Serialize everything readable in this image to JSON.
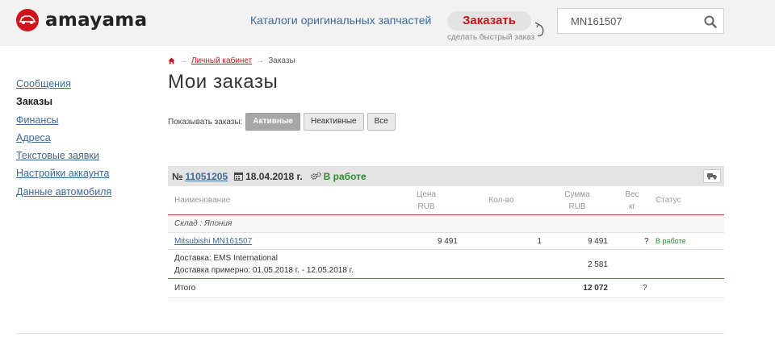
{
  "header": {
    "logo_text": "amayama",
    "catalog_link": "Каталоги оригинальных запчастей",
    "order_button": "Заказать",
    "order_subtext": "сделать быстрый заказ",
    "search_value": "MN161507",
    "search_icon": "search-icon"
  },
  "sidebar": {
    "items": [
      {
        "label": "Сообщения",
        "active": false
      },
      {
        "label": "Заказы",
        "active": true
      },
      {
        "label": "Финансы",
        "active": false
      },
      {
        "label": "Адреса",
        "active": false
      },
      {
        "label": "Текстовые заявки",
        "active": false
      },
      {
        "label": "Настройки аккаунта",
        "active": false
      },
      {
        "label": "Данные автомобиля",
        "active": false
      }
    ]
  },
  "breadcrumb": {
    "home_icon": "home-icon",
    "cabinet": "Личный кабинет",
    "current": "Заказы"
  },
  "page_title": "Мои заказы",
  "filter": {
    "label": "Показывать заказы:",
    "buttons": [
      "Активные",
      "Неактивные",
      "Все"
    ],
    "selected": "Активные"
  },
  "order": {
    "num_prefix": "№",
    "number": "11051205",
    "date": "18.04.2018 г.",
    "status": "В работе",
    "columns": {
      "name": "Наименование",
      "price": "Цена",
      "price_unit": "RUB",
      "qty": "Кол-во",
      "sum": "Сумма",
      "sum_unit": "RUB",
      "weight": "Вес",
      "weight_unit": "кг",
      "status": "Статус"
    },
    "warehouse": "Склад : Япония",
    "item": {
      "name": "Mitsubishi MN161507",
      "price": "9 491",
      "qty": "1",
      "sum": "9 491",
      "weight": "?",
      "status": "В работе"
    },
    "delivery": {
      "method": "Доставка: EMS International",
      "eta": "Доставка примерно: 01.05.2018 г. - 12.05.2018 г.",
      "sum": "2 581"
    },
    "total": {
      "label": "Итого",
      "sum": "12 072",
      "weight": "?"
    }
  },
  "colors": {
    "brand_red": "#c4151c",
    "link_blue": "#3c6a9a",
    "status_green": "#2e8a2e"
  }
}
